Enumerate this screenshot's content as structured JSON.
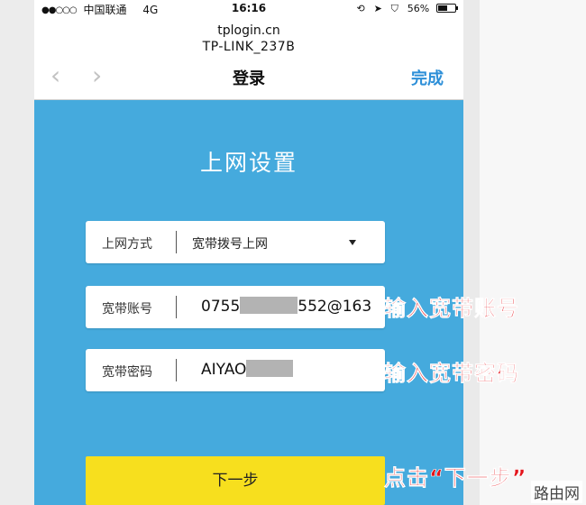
{
  "status_bar": {
    "signal_dots": "●●○○○",
    "carrier": "中国联通",
    "network": "4G",
    "time": "16:16",
    "battery_percent": "56%",
    "battery_level": 0.56
  },
  "browser": {
    "host": "tplogin.cn",
    "page_title_line": "TP-LINK_237B",
    "back_glyph": "‹",
    "forward_glyph": "›",
    "nav_title": "登录",
    "done_label": "完成"
  },
  "main": {
    "heading": "上网设置",
    "connection_type": {
      "label": "上网方式",
      "value": "宽带拨号上网"
    },
    "account": {
      "label": "宽带账号",
      "value_prefix": "0755",
      "value_suffix": "552@163"
    },
    "password": {
      "label": "宽带密码",
      "value_prefix": "AIYAO"
    },
    "next_label": "下一步"
  },
  "annotations": {
    "account": "输入宽带账号",
    "password": "输入宽带密码",
    "next": "点击“下一步”"
  },
  "watermark": "路由网",
  "colors": {
    "content_bg": "#45aadd",
    "button_bg": "#f7df1e",
    "done_link": "#2d8fd8",
    "annotation": "#e4141b"
  }
}
